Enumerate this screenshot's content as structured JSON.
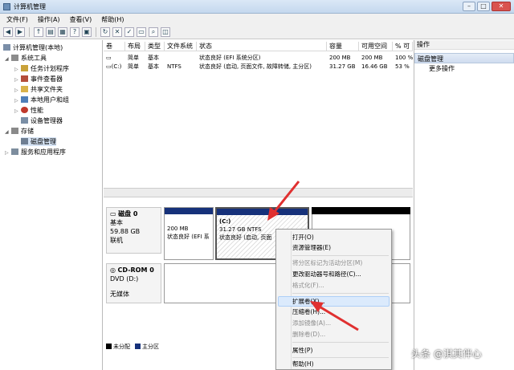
{
  "window": {
    "title": "计算机管理",
    "buttons": {
      "minimize": "–",
      "maximize": "□",
      "close": "✕"
    }
  },
  "menu": [
    "文件(F)",
    "操作(A)",
    "查看(V)",
    "帮助(H)"
  ],
  "tree": {
    "root": "计算机管理(本地)",
    "items": [
      {
        "label": "系统工具"
      },
      {
        "label": "任务计划程序"
      },
      {
        "label": "事件查看器"
      },
      {
        "label": "共享文件夹"
      },
      {
        "label": "本地用户和组"
      },
      {
        "label": "性能"
      },
      {
        "label": "设备管理器"
      },
      {
        "label": "存储"
      },
      {
        "label": "磁盘管理"
      },
      {
        "label": "服务和应用程序"
      }
    ]
  },
  "volumes": {
    "headers": [
      "卷",
      "布局",
      "类型",
      "文件系统",
      "状态",
      "容量",
      "可用空间",
      "% 可"
    ],
    "rows": [
      [
        "",
        "简单",
        "基本",
        "",
        "状态良好 (EFI 系统分区)",
        "200 MB",
        "200 MB",
        "100 %"
      ],
      [
        "(C:)",
        "简单",
        "基本",
        "NTFS",
        "状态良好 (启动, 页面文件, 故障转储, 主分区)",
        "31.27 GB",
        "16.46 GB",
        "53 %"
      ]
    ]
  },
  "disks": {
    "disk0": {
      "name": "磁盘 0",
      "type": "基本",
      "size": "59.88 GB",
      "status": "联机",
      "partitions": [
        {
          "size": "200 MB",
          "status": "状态良好 (EFI 系"
        },
        {
          "name": "(C:)",
          "size": "31.27 GB NTFS",
          "status": "状态良好 (启动, 页面"
        }
      ]
    },
    "cdrom": {
      "name": "CD-ROM 0",
      "drive": "DVD (D:)",
      "status": "无媒体"
    },
    "legend": [
      {
        "label": "未分配",
        "color": "#000000"
      },
      {
        "label": "主分区",
        "color": "#16317a"
      }
    ]
  },
  "actions": {
    "title": "操作",
    "section": "磁盘管理",
    "more": "更多操作"
  },
  "context_menu": {
    "items": [
      {
        "label": "打开(O)",
        "enabled": true
      },
      {
        "label": "资源管理器(E)",
        "enabled": true
      },
      {
        "label": "将分区标记为活动分区(M)",
        "enabled": false
      },
      {
        "label": "更改驱动器号和路径(C)...",
        "enabled": true
      },
      {
        "label": "格式化(F)...",
        "enabled": false
      },
      {
        "label": "扩展卷(X)...",
        "enabled": true,
        "highlighted": true
      },
      {
        "label": "压缩卷(H)...",
        "enabled": true
      },
      {
        "label": "添加镜像(A)...",
        "enabled": false
      },
      {
        "label": "删除卷(D)...",
        "enabled": false
      },
      {
        "label": "属性(P)",
        "enabled": true
      },
      {
        "label": "帮助(H)",
        "enabled": true
      }
    ]
  },
  "watermark": "头条 @淇其伴心",
  "colors": {
    "primary_partition": "#16317a",
    "unallocated": "#000000",
    "annotation_arrow": "#e03030"
  }
}
